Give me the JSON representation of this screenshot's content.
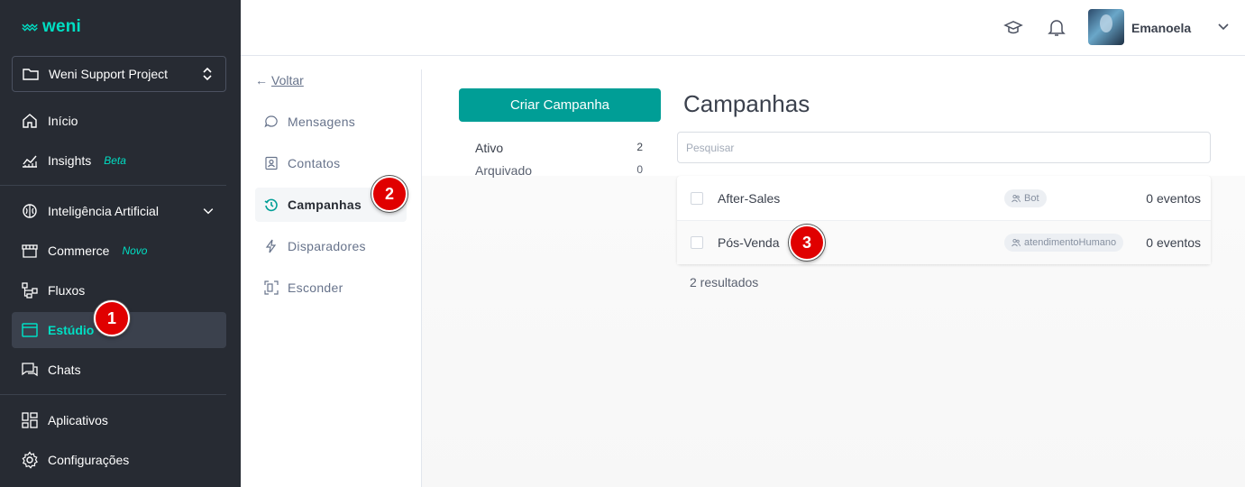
{
  "brand": {
    "name": "weni",
    "accent": "#00dec3",
    "primary": "#009e96"
  },
  "project": {
    "name": "Weni Support Project"
  },
  "sidebar": {
    "items": [
      {
        "label": "Início",
        "icon": "home-icon"
      },
      {
        "label": "Insights",
        "tag": "Beta",
        "icon": "chart-icon"
      },
      {
        "label": "Inteligência Artificial",
        "icon": "brain-icon"
      },
      {
        "label": "Commerce",
        "tag": "Novo",
        "icon": "store-icon"
      },
      {
        "label": "Fluxos",
        "icon": "flow-icon"
      },
      {
        "label": "Estúdio",
        "icon": "studio-icon",
        "active": true
      },
      {
        "label": "Chats",
        "icon": "chat-icon"
      },
      {
        "label": "Aplicativos",
        "icon": "apps-icon"
      },
      {
        "label": "Configurações",
        "icon": "gear-icon"
      }
    ]
  },
  "topbar": {
    "user": "Emanoela"
  },
  "submenu": {
    "back": "Voltar",
    "items": [
      {
        "label": "Mensagens",
        "icon": "message-icon"
      },
      {
        "label": "Contatos",
        "icon": "contact-icon"
      },
      {
        "label": "Campanhas",
        "icon": "campaign-icon",
        "active": true
      },
      {
        "label": "Disparadores",
        "icon": "bolt-icon"
      },
      {
        "label": "Esconder",
        "icon": "hide-icon"
      }
    ]
  },
  "main": {
    "create_button": "Criar Campanha",
    "filters": [
      {
        "label": "Ativo",
        "count": "2"
      },
      {
        "label": "Arquivado",
        "count": "0"
      }
    ],
    "title": "Campanhas",
    "search_placeholder": "Pesquisar",
    "campaigns": [
      {
        "name": "After-Sales",
        "group": "Bot",
        "events": "0 eventos"
      },
      {
        "name": "Pós-Venda",
        "group": "atendimentoHumano",
        "events": "0 eventos"
      }
    ],
    "results": "2 resultados"
  },
  "badges": [
    "1",
    "2",
    "3"
  ]
}
